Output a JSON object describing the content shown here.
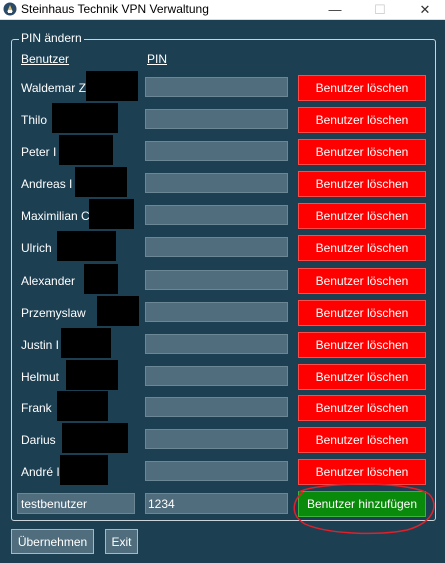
{
  "window": {
    "title": "Steinhaus Technik VPN Verwaltung",
    "controls": {
      "minimize": "—",
      "maximize": "☐",
      "close": "✕"
    }
  },
  "group": {
    "title": "PIN ändern",
    "headers": {
      "user": "Benutzer",
      "pin": "PIN"
    }
  },
  "users": [
    {
      "name": "Waldemar Z",
      "pin": "",
      "delete_label": "Benutzer löschen"
    },
    {
      "name": "Thilo",
      "pin": "",
      "delete_label": "Benutzer löschen"
    },
    {
      "name": "Peter I",
      "pin": "",
      "delete_label": "Benutzer löschen"
    },
    {
      "name": "Andreas I",
      "pin": "",
      "delete_label": "Benutzer löschen"
    },
    {
      "name": "Maximilian C",
      "pin": "",
      "delete_label": "Benutzer löschen"
    },
    {
      "name": "Ulrich",
      "pin": "",
      "delete_label": "Benutzer löschen"
    },
    {
      "name": "Alexander",
      "pin": "",
      "delete_label": "Benutzer löschen"
    },
    {
      "name": "Przemyslaw",
      "pin": "",
      "delete_label": "Benutzer löschen"
    },
    {
      "name": "Justin I",
      "pin": "",
      "delete_label": "Benutzer löschen"
    },
    {
      "name": "Helmut",
      "pin": "",
      "delete_label": "Benutzer löschen"
    },
    {
      "name": "Frank",
      "pin": "",
      "delete_label": "Benutzer löschen"
    },
    {
      "name": "Darius",
      "pin": "",
      "delete_label": "Benutzer löschen"
    },
    {
      "name": "André I",
      "pin": "",
      "delete_label": "Benutzer löschen"
    }
  ],
  "new_user": {
    "name_value": "testbenutzer",
    "pin_value": "1234",
    "add_label": "Benutzer hinzufügen"
  },
  "footer": {
    "apply_label": "Übernehmen",
    "exit_label": "Exit"
  },
  "colors": {
    "background": "#1d3f52",
    "delete": "#ff0000",
    "add": "#0a8a0a",
    "input": "#4f6d7c",
    "annotation": "#e0202a"
  }
}
